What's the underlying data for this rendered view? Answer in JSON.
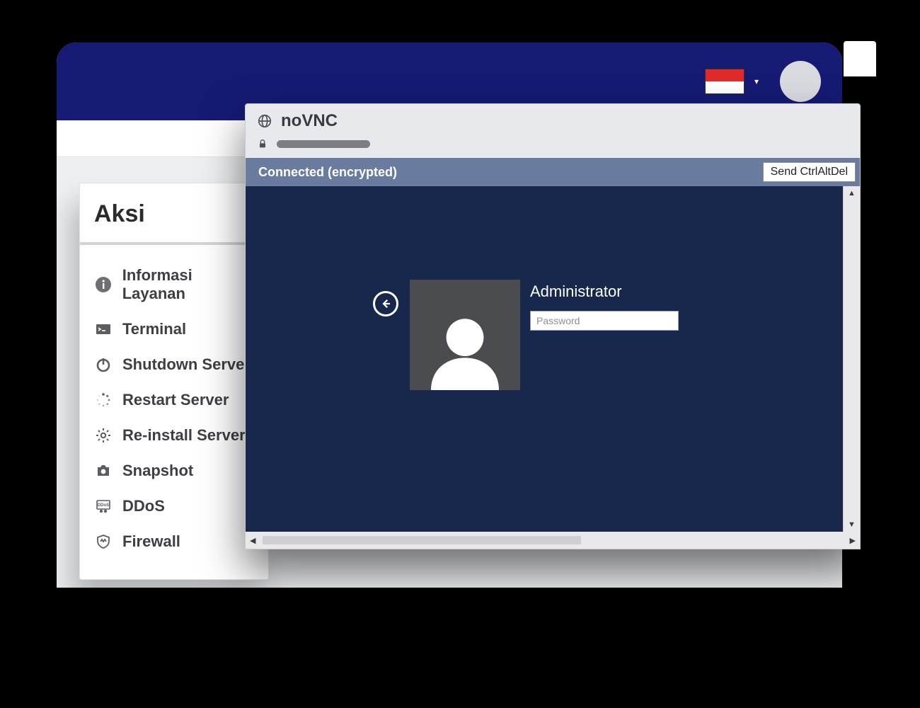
{
  "header": {
    "locale_flag": "id",
    "dropdown_caret": "▾"
  },
  "sidebar": {
    "title": "Aksi",
    "items": [
      {
        "icon": "info-icon",
        "label": "Informasi Layanan"
      },
      {
        "icon": "terminal-icon",
        "label": "Terminal"
      },
      {
        "icon": "power-icon",
        "label": "Shutdown Server"
      },
      {
        "icon": "spinner-icon",
        "label": "Restart Server"
      },
      {
        "icon": "gear-icon",
        "label": "Re-install Server"
      },
      {
        "icon": "camera-icon",
        "label": "Snapshot"
      },
      {
        "icon": "ddos-icon",
        "label": "DDoS"
      },
      {
        "icon": "shield-icon",
        "label": "Firewall"
      }
    ]
  },
  "vnc": {
    "app_title": "noVNC",
    "status_text": "Connected (encrypted)",
    "cad_button": "Send CtrlAltDel",
    "login": {
      "username": "Administrator",
      "password_placeholder": "Password"
    }
  }
}
